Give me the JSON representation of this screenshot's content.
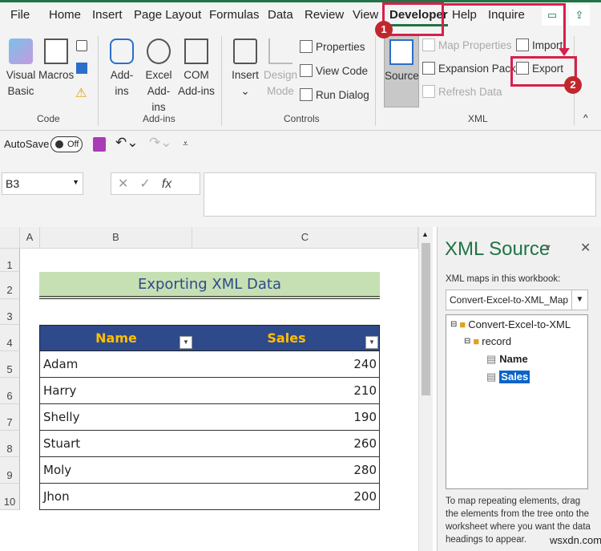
{
  "tabs": [
    "File",
    "Home",
    "Insert",
    "Page Layout",
    "Formulas",
    "Data",
    "Review",
    "View",
    "Developer",
    "Help",
    "Inquire"
  ],
  "ribbon": {
    "code": {
      "label": "Code",
      "visual_basic": "Visual Basic",
      "macros": "Macros"
    },
    "addins": {
      "label": "Add-ins",
      "addins": "Add-ins",
      "excel_addins": "Excel Add-ins",
      "com_addins": "COM Add-ins"
    },
    "controls": {
      "label": "Controls",
      "insert": "Insert",
      "design_mode": "Design Mode",
      "properties": "Properties",
      "view_code": "View Code",
      "run_dialog": "Run Dialog"
    },
    "xml": {
      "label": "XML",
      "source": "Source",
      "map_properties": "Map Properties",
      "expansion_packs": "Expansion Packs",
      "refresh_data": "Refresh Data",
      "import": "Import",
      "export": "Export"
    }
  },
  "annotations": {
    "step1": "1",
    "step2": "2"
  },
  "qat": {
    "autosave": "AutoSave",
    "toggle": "Off"
  },
  "formula_bar": {
    "name_box": "B3",
    "fx": "fx",
    "value": ""
  },
  "columns": [
    "A",
    "B",
    "C"
  ],
  "rows": [
    "1",
    "2",
    "3",
    "4",
    "5",
    "6",
    "7",
    "8",
    "9",
    "10"
  ],
  "sheet": {
    "title": "Exporting XML Data",
    "headers": [
      "Name",
      "Sales"
    ],
    "data": [
      [
        "Adam",
        "240"
      ],
      [
        "Harry",
        "210"
      ],
      [
        "Shelly",
        "190"
      ],
      [
        "Stuart",
        "260"
      ],
      [
        "Moly",
        "280"
      ],
      [
        "Jhon",
        "200"
      ]
    ]
  },
  "xml_panel": {
    "title": "XML Source",
    "maps_label": "XML maps in this workbook:",
    "map": "Convert-Excel-to-XML_Map",
    "tree": {
      "root": "Convert-Excel-to-XML",
      "record": "record",
      "fields": [
        "Name",
        "Sales"
      ]
    },
    "hint": "To map repeating elements, drag the elements from the tree onto the worksheet where you want the data headings to appear."
  },
  "watermark": "wsxdn.com",
  "colors": {
    "accent": "#217346",
    "table_header": "#2f4a8a",
    "header_text": "#ffc000",
    "title_fill": "#c6e0b4",
    "annotation": "#d81f4a"
  }
}
